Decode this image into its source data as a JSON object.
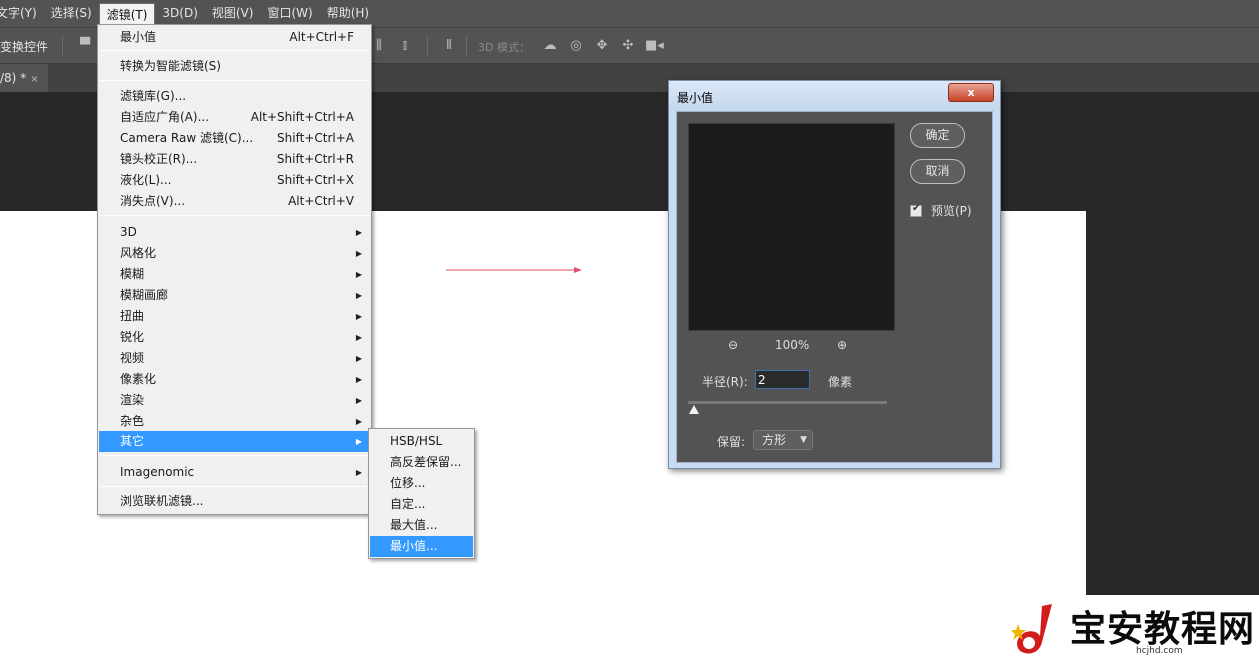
{
  "menubar": {
    "items": [
      "文字(Y)",
      "选择(S)",
      "滤镜(T)",
      "3D(D)",
      "视图(V)",
      "窗口(W)",
      "帮助(H)"
    ]
  },
  "optionsbar": {
    "label": "变换控件",
    "mode_label": "3D 模式："
  },
  "doc_tab": {
    "label": "/8) *",
    "close": "×"
  },
  "filter_menu": {
    "items": [
      {
        "label": "最小值",
        "shortcut": "Alt+Ctrl+F"
      },
      {
        "label": "转换为智能滤镜(S)",
        "shortcut": ""
      },
      {
        "label": "滤镜库(G)...",
        "shortcut": ""
      },
      {
        "label": "自适应广角(A)...",
        "shortcut": "Alt+Shift+Ctrl+A"
      },
      {
        "label": "Camera Raw 滤镜(C)...",
        "shortcut": "Shift+Ctrl+A"
      },
      {
        "label": "镜头校正(R)...",
        "shortcut": "Shift+Ctrl+R"
      },
      {
        "label": "液化(L)...",
        "shortcut": "Shift+Ctrl+X"
      },
      {
        "label": "消失点(V)...",
        "shortcut": "Alt+Ctrl+V"
      },
      {
        "label": "3D"
      },
      {
        "label": "风格化"
      },
      {
        "label": "模糊"
      },
      {
        "label": "模糊画廊"
      },
      {
        "label": "扭曲"
      },
      {
        "label": "锐化"
      },
      {
        "label": "视频"
      },
      {
        "label": "像素化"
      },
      {
        "label": "渲染"
      },
      {
        "label": "杂色"
      },
      {
        "label": "其它"
      },
      {
        "label": "Imagenomic"
      },
      {
        "label": "浏览联机滤镜..."
      }
    ]
  },
  "other_submenu": {
    "items": [
      "HSB/HSL",
      "高反差保留...",
      "位移...",
      "自定...",
      "最大值...",
      "最小值..."
    ]
  },
  "dialog": {
    "title": "最小值",
    "close": "x",
    "ok": "确定",
    "cancel": "取消",
    "preview_label": "预览(P)",
    "preview_checked": true,
    "zoom": "100%",
    "radius_label": "半径(R):",
    "radius_value": "2",
    "unit": "像素",
    "slider_level": 0.02,
    "keep_label": "保留:",
    "keep_value": "方形"
  },
  "watermark": {
    "text": "宝安教程网",
    "url": "hcjhd.com"
  },
  "colors": {
    "menu_highlight": "#3399ff",
    "arrow": "#e0506a",
    "dialog_frame": "#c7dcf2"
  }
}
